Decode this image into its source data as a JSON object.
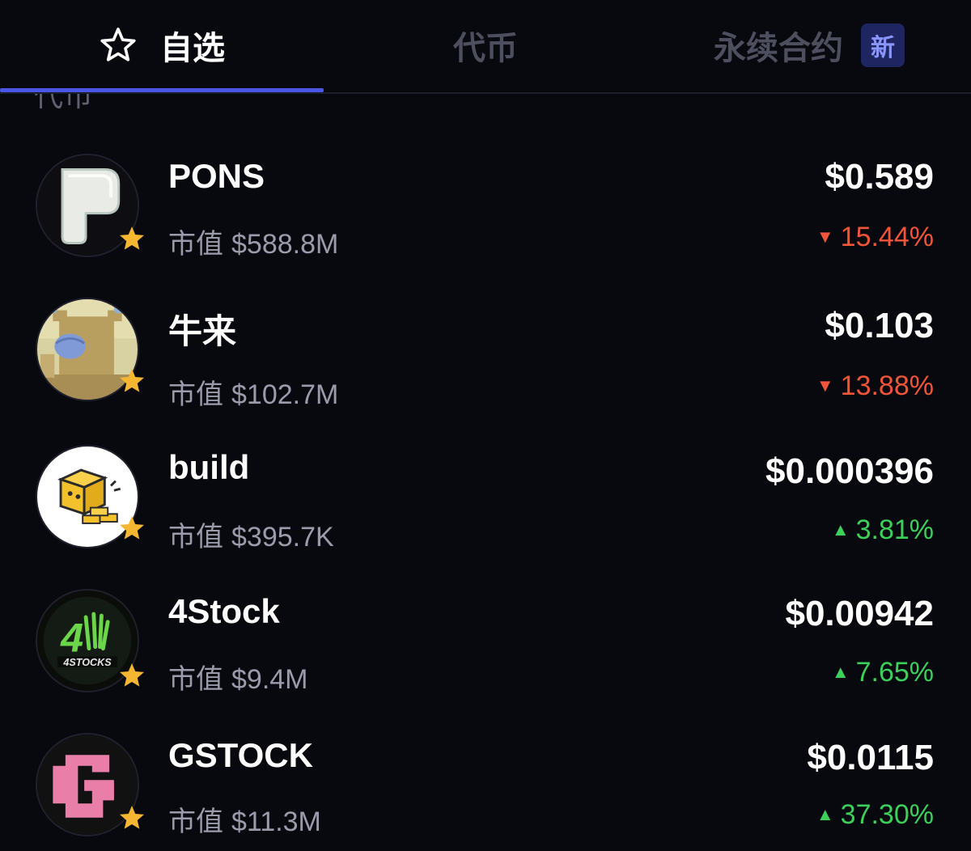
{
  "tabs": {
    "watchlist": "自选",
    "tokens": "代币",
    "perpetuals": "永续合约",
    "new_badge": "新"
  },
  "section": {
    "label": "代币"
  },
  "mcap_label": "市值",
  "tokens": [
    {
      "name": "PONS",
      "mcap": "$588.8M",
      "price": "$0.589",
      "change": "15.44%",
      "direction": "down",
      "arrow": "▼",
      "icon": "pons-logo-icon"
    },
    {
      "name": "牛来",
      "mcap": "$102.7M",
      "price": "$0.103",
      "change": "13.88%",
      "direction": "down",
      "arrow": "▼",
      "icon": "bull-avatar-icon"
    },
    {
      "name": "build",
      "mcap": "$395.7K",
      "price": "$0.000396",
      "change": "3.81%",
      "direction": "up",
      "arrow": "▲",
      "icon": "build-block-icon"
    },
    {
      "name": "4Stock",
      "mcap": "$9.4M",
      "price": "$0.00942",
      "change": "7.65%",
      "direction": "up",
      "arrow": "▲",
      "icon": "4stocks-logo-icon"
    },
    {
      "name": "GSTOCK",
      "mcap": "$11.3M",
      "price": "$0.0115",
      "change": "37.30%",
      "direction": "up",
      "arrow": "▲",
      "icon": "gstock-logo-icon"
    }
  ],
  "colors": {
    "background": "#08080f",
    "accent": "#4a57e6",
    "down": "#f0553a",
    "up": "#3ccf5a",
    "favorite_star": "#f5b731"
  }
}
